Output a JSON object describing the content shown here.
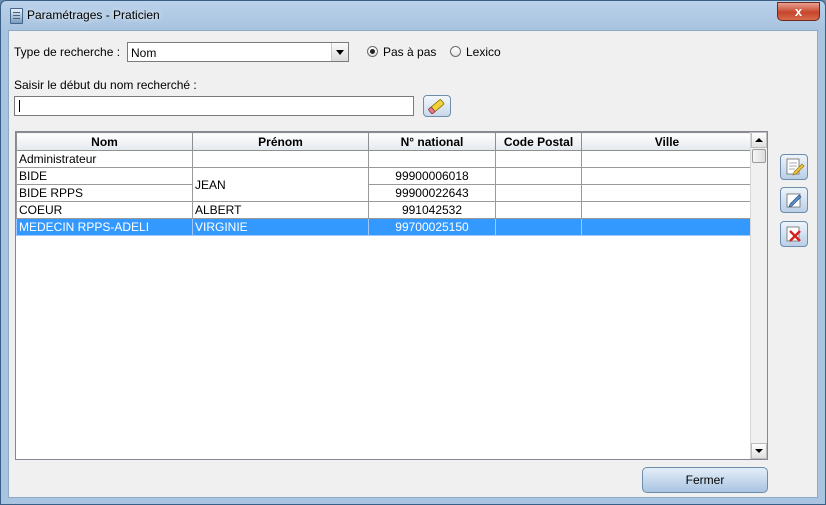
{
  "window": {
    "title": "Paramétrages - Praticien",
    "close_label": "x"
  },
  "search": {
    "type_label": "Type de recherche :",
    "type_value": "Nom",
    "mode_options": [
      {
        "label": "Pas à pas",
        "selected": true
      },
      {
        "label": "Lexico",
        "selected": false
      }
    ],
    "input_label": "Saisir le début du nom recherché :",
    "input_value": ""
  },
  "table": {
    "columns": [
      "Nom",
      "Prénom",
      "N° national",
      "Code Postal",
      "Ville"
    ],
    "rows": [
      {
        "nom": "Administrateur",
        "prenom": "",
        "national": "",
        "cp": "",
        "ville": ""
      },
      {
        "nom": "BIDE",
        "prenom": "JEAN",
        "national": "99900006018",
        "cp": "",
        "ville": ""
      },
      {
        "nom": "BIDE RPPS",
        "prenom": "",
        "national": "99900022643",
        "cp": "",
        "ville": ""
      },
      {
        "nom": "COEUR",
        "prenom": "ALBERT",
        "national": "991042532",
        "cp": "",
        "ville": ""
      },
      {
        "nom": "MEDECIN RPPS-ADELI",
        "prenom": "VIRGINIE",
        "national": "99700025150",
        "cp": "",
        "ville": "",
        "selected": true
      }
    ]
  },
  "side_buttons": [
    "edit-icon",
    "pencil-edit-icon",
    "delete-icon"
  ],
  "footer": {
    "close_button": "Fermer"
  },
  "colors": {
    "selection": "#3399ff",
    "title_bar": "#b9d1ea",
    "close_button": "#c6462c"
  }
}
